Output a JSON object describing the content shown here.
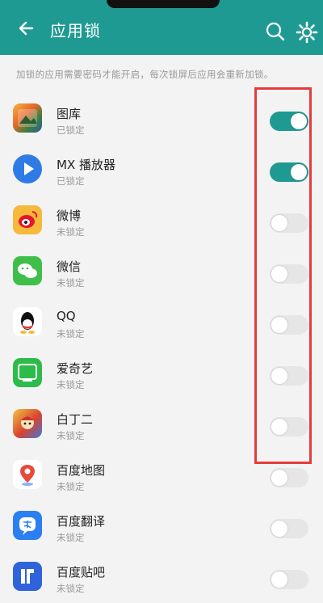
{
  "header": {
    "title": "应用锁"
  },
  "hint": "加锁的应用需要密码才能开启，每次锁屏后应用会重新加锁。",
  "apps": [
    {
      "name": "图库",
      "status": "已锁定",
      "locked": true,
      "icon": "gallery-icon"
    },
    {
      "name": "MX 播放器",
      "status": "已锁定",
      "locked": true,
      "icon": "play-icon"
    },
    {
      "name": "微博",
      "status": "未锁定",
      "locked": false,
      "icon": "weibo-icon"
    },
    {
      "name": "微信",
      "status": "未锁定",
      "locked": false,
      "icon": "wechat-icon"
    },
    {
      "name": "QQ",
      "status": "未锁定",
      "locked": false,
      "icon": "qq-icon"
    },
    {
      "name": "爱奇艺",
      "status": "未锁定",
      "locked": false,
      "icon": "iqiyi-icon"
    },
    {
      "name": "白丁二",
      "status": "未锁定",
      "locked": false,
      "icon": "game-icon"
    },
    {
      "name": "百度地图",
      "status": "未锁定",
      "locked": false,
      "icon": "map-icon"
    },
    {
      "name": "百度翻译",
      "status": "未锁定",
      "locked": false,
      "icon": "translate-icon"
    },
    {
      "name": "百度贴吧",
      "status": "未锁定",
      "locked": false,
      "icon": "tieba-icon"
    }
  ],
  "colors": {
    "accent": "#1f9a92",
    "highlight": "#e53b3b"
  }
}
